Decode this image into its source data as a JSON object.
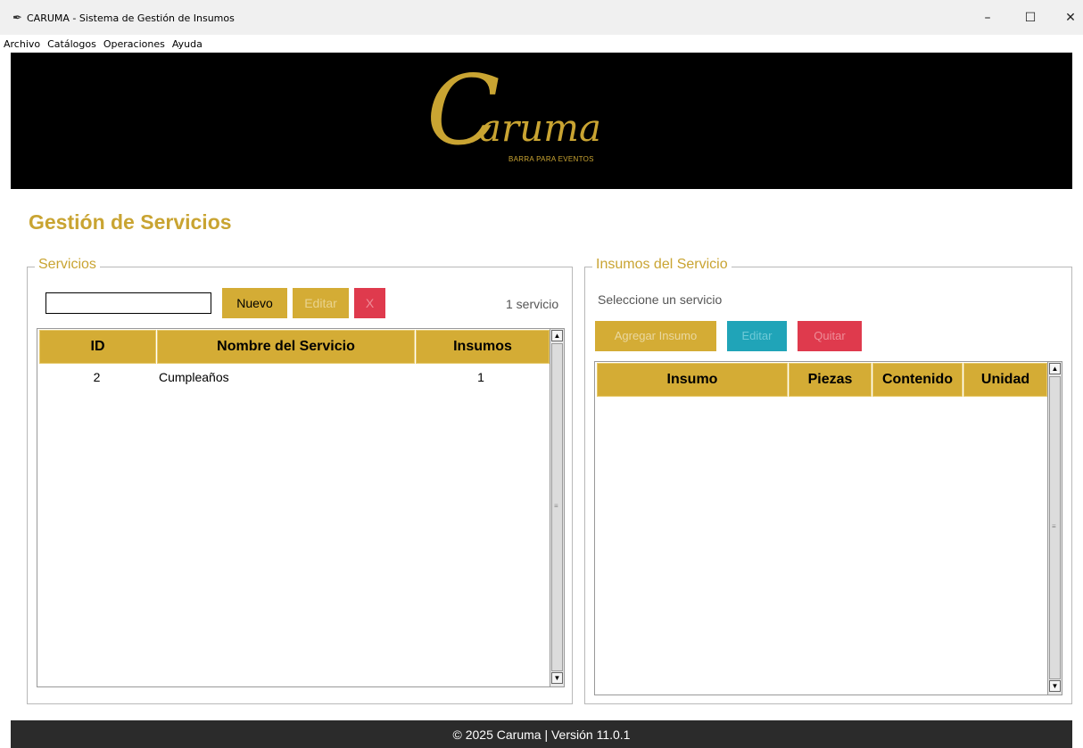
{
  "window": {
    "title": "CARUMA - Sistema de Gestión de Insumos",
    "app_icon": "feather-icon",
    "minimize_glyph": "–",
    "maximize_glyph": "☐",
    "close_glyph": "✕"
  },
  "menu": [
    "Archivo",
    "Catálogos",
    "Operaciones",
    "Ayuda"
  ],
  "banner": {
    "logo_initial": "C",
    "logo_rest": "aruma",
    "logo_tagline": "BARRA PARA EVENTOS"
  },
  "page_title": "Gestión de Servicios",
  "servicios": {
    "legend": "Servicios",
    "search_value": "",
    "nuevo_label": "Nuevo",
    "editar_label": "Editar",
    "delete_label": "X",
    "count_label": "1 servicio",
    "columns": [
      "ID",
      "Nombre del Servicio",
      "Insumos"
    ],
    "rows": [
      {
        "id": "2",
        "nombre": "Cumpleaños",
        "insumos": "1"
      }
    ]
  },
  "insumos": {
    "legend": "Insumos del Servicio",
    "hint": "Seleccione un servicio",
    "agregar_label": "Agregar Insumo",
    "editar_label": "Editar",
    "quitar_label": "Quitar",
    "columns": [
      "Insumo",
      "Piezas",
      "Contenido",
      "Unidad"
    ],
    "rows": []
  },
  "footer": {
    "text": "© 2025 Caruma | Versión 11.0.1"
  },
  "colors": {
    "accent_gold": "#d4ac35",
    "danger_red": "#df3a4d",
    "info_teal": "#20a4b8",
    "banner_bg": "#000000",
    "footer_bg": "#2b2b2b"
  }
}
